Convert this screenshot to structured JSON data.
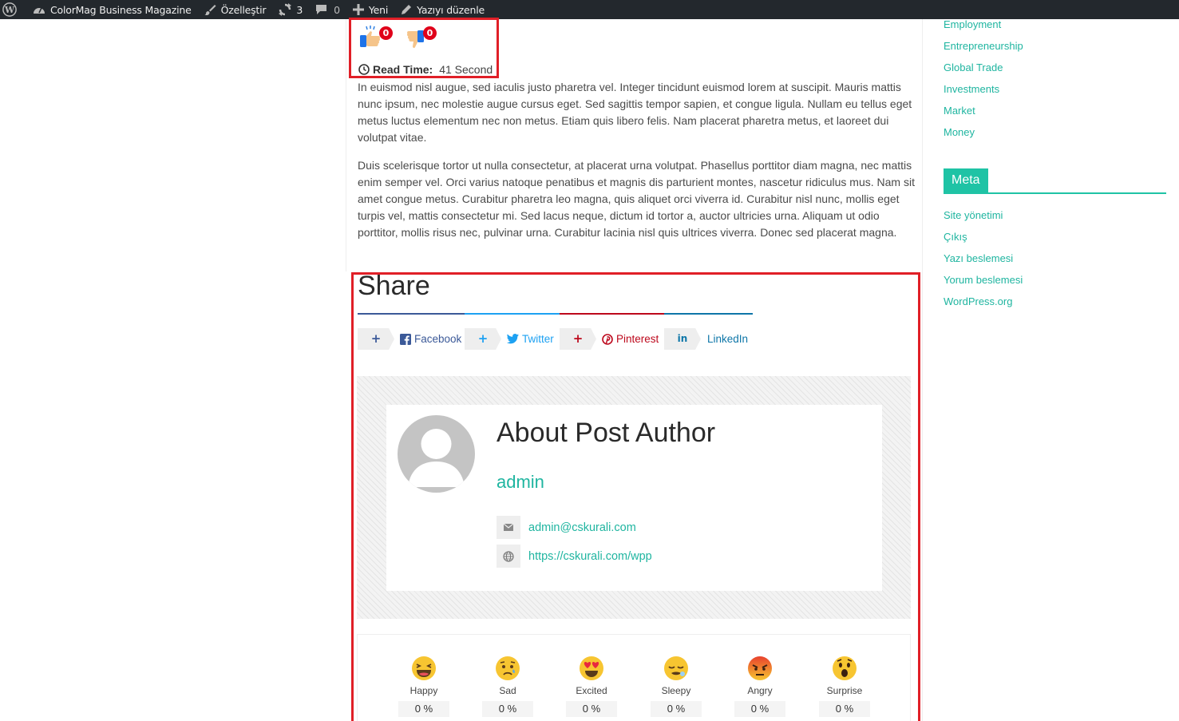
{
  "admin_bar": {
    "site_name": "ColorMag Business Magazine",
    "customize": "Özelleştir",
    "updates_count": "3",
    "comments_count": "0",
    "new": "Yeni",
    "edit_post": "Yazıyı düzenle"
  },
  "post": {
    "likes": {
      "like_count": "0",
      "dislike_count": "0"
    },
    "read_time": {
      "label": "Read Time:",
      "value": "41 Second"
    },
    "paragraphs": [
      "In euismod nisl augue, sed iaculis justo pharetra vel. Integer tincidunt euismod lorem at suscipit. Mauris mattis nunc ipsum, nec molestie augue cursus eget. Sed sagittis tempor sapien, et congue ligula. Nullam eu tellus eget metus luctus elementum nec non metus. Etiam quis libero felis. Nam placerat pharetra metus, et laoreet dui volutpat vitae.",
      "Duis scelerisque tortor ut nulla consectetur, at placerat urna volutpat. Phasellus porttitor diam magna, nec mattis enim semper vel. Orci varius natoque penatibus et magnis dis parturient montes, nascetur ridiculus mus. Nam sit amet congue metus. Curabitur pharetra leo magna, quis aliquet orci viverra id. Curabitur nisl nunc, mollis eget turpis vel, mattis consectetur mi. Sed lacus neque, dictum id tortor a, auctor ultricies urna. Aliquam ut odio porttitor, mollis risus nec, pulvinar urna. Curabitur lacinia nisl quis ultrices viverra. Donec sed placerat magna."
    ]
  },
  "share": {
    "title": "Share",
    "buttons": [
      {
        "plus": "+",
        "label": "Facebook",
        "color": "#3b5998"
      },
      {
        "plus": "+",
        "label": "Twitter",
        "color": "#1da1f2"
      },
      {
        "plus": "+",
        "label": "Pinterest",
        "color": "#bd081c"
      },
      {
        "plus": "in",
        "label": "LinkedIn",
        "color": "#0e76a8"
      }
    ],
    "line_colors": [
      "#3b5998",
      "#1da1f2",
      "#bd081c",
      "#0e76a8"
    ]
  },
  "author": {
    "title": "About Post Author",
    "name": "admin",
    "email": "admin@cskurali.com",
    "website": "https://cskurali.com/wpp"
  },
  "reactions": [
    {
      "label": "Happy",
      "percent": "0 %",
      "icon": "laughing-emoji"
    },
    {
      "label": "Sad",
      "percent": "0 %",
      "icon": "sad-emoji"
    },
    {
      "label": "Excited",
      "percent": "0 %",
      "icon": "heart-eyes-emoji"
    },
    {
      "label": "Sleepy",
      "percent": "0 %",
      "icon": "sleepy-emoji"
    },
    {
      "label": "Angry",
      "percent": "0 %",
      "icon": "angry-emoji"
    },
    {
      "label": "Surprise",
      "percent": "0 %",
      "icon": "surprised-emoji"
    }
  ],
  "sidebar": {
    "categories": [
      "Employment",
      "Entrepreneurship",
      "Global Trade",
      "Investments",
      "Market",
      "Money"
    ],
    "meta_title": "Meta",
    "meta_links": [
      "Site yönetimi",
      "Çıkış",
      "Yazı beslemesi",
      "Yorum beslemesi",
      "WordPress.org"
    ]
  },
  "colors": {
    "accent": "#1fb5a0",
    "meta_heading": "#1fc3a5",
    "highlight_border": "#e01f27",
    "admin_bar": "#23282d"
  }
}
